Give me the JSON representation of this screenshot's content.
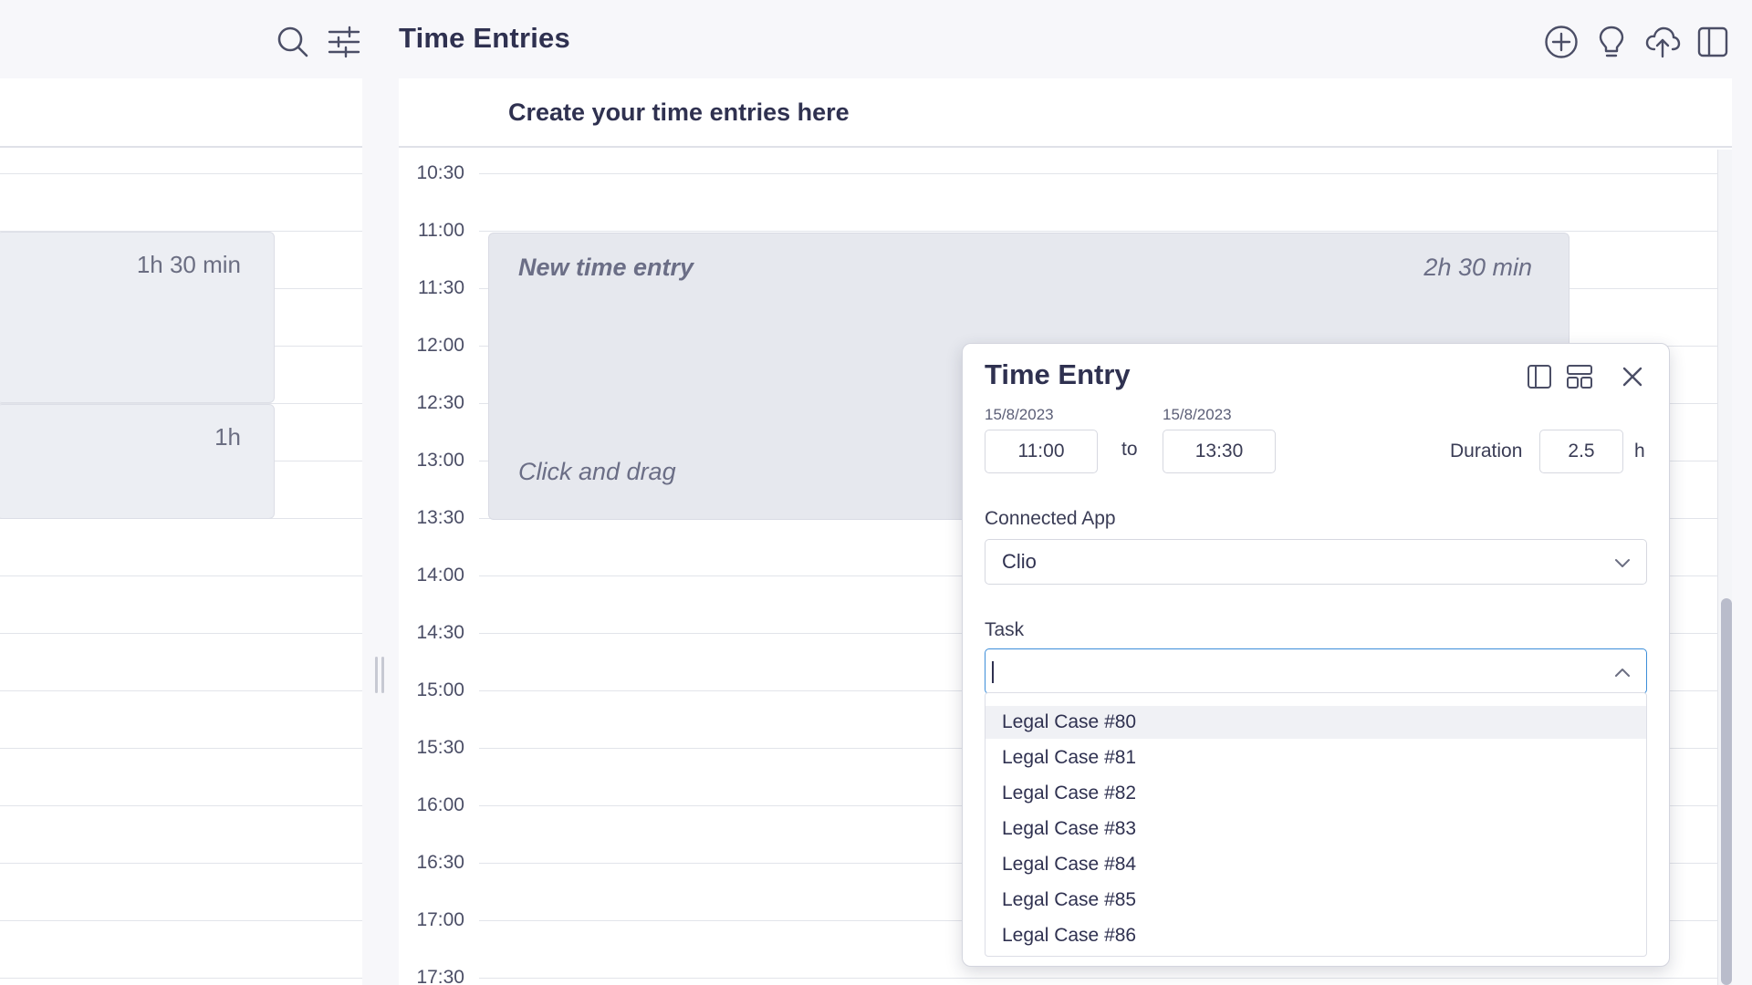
{
  "header": {
    "title": "Time Entries",
    "icons": [
      "search-icon",
      "filter-sliders-icon",
      "add-circle-icon",
      "lightbulb-icon",
      "cloud-upload-icon",
      "sidebar-panel-icon"
    ]
  },
  "left_panel": {
    "entries": [
      {
        "duration": "1h 30 min"
      },
      {
        "duration": "1h"
      }
    ]
  },
  "calendar": {
    "subtitle": "Create your time entries here",
    "times": [
      "10:30",
      "11:00",
      "11:30",
      "12:00",
      "12:30",
      "13:00",
      "13:30",
      "14:00",
      "14:30",
      "15:00",
      "15:30",
      "16:00",
      "16:30",
      "17:00",
      "17:30"
    ],
    "new_entry": {
      "title": "New time entry",
      "duration": "2h 30 min",
      "hint": "Click and drag"
    }
  },
  "dialog": {
    "title": "Time Entry",
    "start_date": "15/8/2023",
    "end_date": "15/8/2023",
    "start_time": "11:00",
    "end_time": "13:30",
    "to_label": "to",
    "duration_label": "Duration",
    "duration_value": "2.5",
    "duration_unit": "h",
    "connected_app_label": "Connected App",
    "connected_app_value": "Clio",
    "task_label": "Task",
    "task_value": "",
    "task_options": [
      "Legal Case #80",
      "Legal Case #81",
      "Legal Case #82",
      "Legal Case #83",
      "Legal Case #84",
      "Legal Case #85",
      "Legal Case #86"
    ],
    "icons": [
      "split-view-icon",
      "layout-icon",
      "close-icon"
    ]
  },
  "colors": {
    "accent_focus": "#3d8ed9",
    "entry_fill": "#e6e8ee",
    "scroll_thumb": "#b9bccb"
  }
}
